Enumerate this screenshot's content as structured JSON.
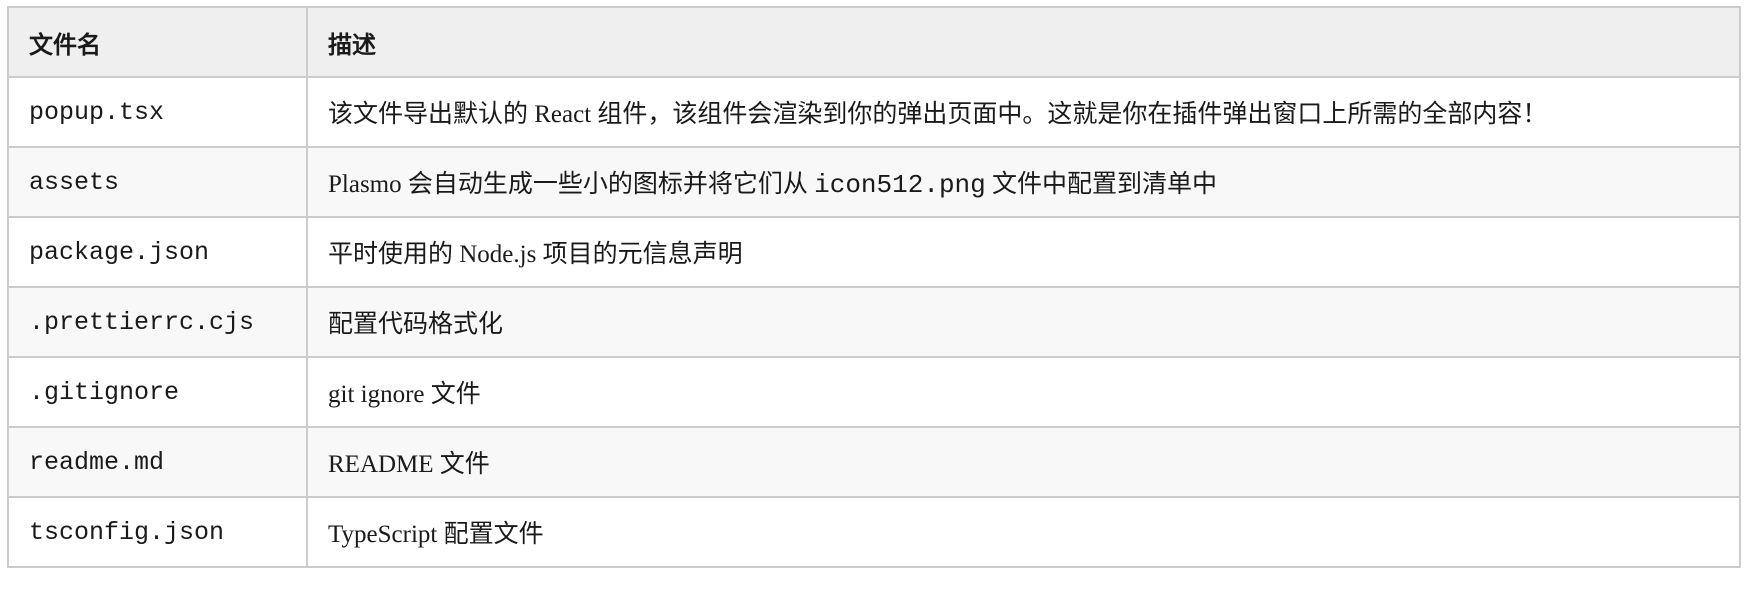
{
  "table": {
    "headers": {
      "file": "文件名",
      "description": "描述"
    },
    "rows": [
      {
        "file": "popup.tsx",
        "description": "该文件导出默认的 React 组件，该组件会渲染到你的弹出页面中。这就是你在插件弹出窗口上所需的全部内容！"
      },
      {
        "file": "assets",
        "description_before": "Plasmo 会自动生成一些小的图标并将它们从 ",
        "description_code": "icon512.png",
        "description_after": " 文件中配置到清单中"
      },
      {
        "file": "package.json",
        "description": "平时使用的 Node.js 项目的元信息声明"
      },
      {
        "file": ".prettierrc.cjs",
        "description": "配置代码格式化"
      },
      {
        "file": ".gitignore",
        "description": "git ignore 文件"
      },
      {
        "file": "readme.md",
        "description": "README 文件"
      },
      {
        "file": "tsconfig.json",
        "description": "TypeScript 配置文件"
      }
    ]
  },
  "colors": {
    "header_bg": "#efefef",
    "border": "#cccccc",
    "row_alt_bg": "#f8f8f8"
  }
}
